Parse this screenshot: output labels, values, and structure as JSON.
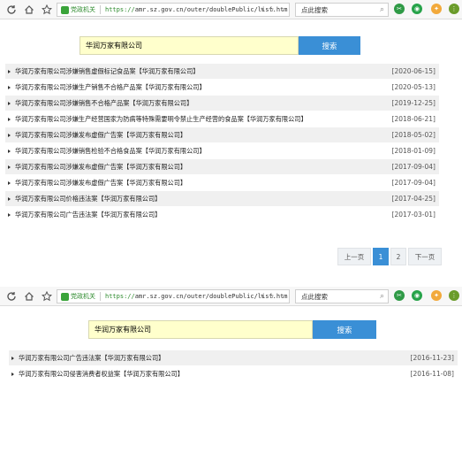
{
  "browser": {
    "verified_label": "党政机关",
    "url_scheme": "https://",
    "url_rest": "amr.sz.gov.cn/outer/doublePublic/list.htm",
    "search_placeholder": "点此搜索"
  },
  "search": {
    "company": "华润万家有限公司",
    "button": "搜索"
  },
  "list_page1": [
    {
      "title": "华润万家有限公司涉嫌销售虚假标记食品案【华润万家有限公司】",
      "date": "[2020-06-15]"
    },
    {
      "title": "华润万家有限公司涉嫌生产销售不合格产品案【华润万家有限公司】",
      "date": "[2020-05-13]"
    },
    {
      "title": "华润万家有限公司涉嫌销售不合格产品案【华润万家有限公司】",
      "date": "[2019-12-25]"
    },
    {
      "title": "华润万家有限公司涉嫌生产经营国家为防病等特殊需要明令禁止生产经营的食品案【华润万家有限公司】",
      "date": "[2018-06-21]"
    },
    {
      "title": "华润万家有限公司涉嫌发布虚假广告案【华润万家有限公司】",
      "date": "[2018-05-02]"
    },
    {
      "title": "华润万家有限公司涉嫌销售检验不合格食品案【华润万家有限公司】",
      "date": "[2018-01-09]"
    },
    {
      "title": "华润万家有限公司涉嫌发布虚假广告案【华润万家有限公司】",
      "date": "[2017-09-04]"
    },
    {
      "title": "华润万家有限公司涉嫌发布虚假广告案【华润万家有限公司】",
      "date": "[2017-09-04]"
    },
    {
      "title": "华润万家有限公司价格违法案【华润万家有限公司】",
      "date": "[2017-04-25]"
    },
    {
      "title": "华润万家有限公司广告违法案【华润万家有限公司】",
      "date": "[2017-03-01]"
    }
  ],
  "pager": {
    "prev": "上一页",
    "page1": "1",
    "page2": "2",
    "next": "下一页"
  },
  "list_page2": [
    {
      "title": "华润万家有限公司广告违法案【华润万家有限公司】",
      "date": "[2016-11-23]"
    },
    {
      "title": "华润万家有限公司侵害消费者权益案【华润万家有限公司】",
      "date": "[2016-11-08]"
    }
  ],
  "colors": {
    "accent": "#3a8fd6",
    "input_bg": "#ffffcc",
    "row_alt": "#f0f0f0"
  }
}
